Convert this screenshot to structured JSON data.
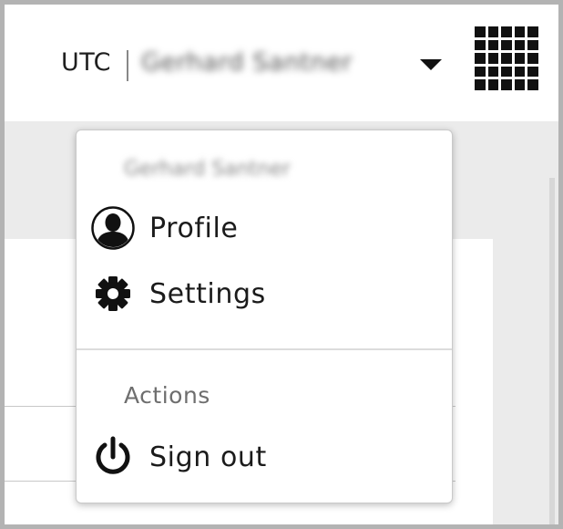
{
  "header": {
    "timezone": "UTC",
    "username": "Gerhard Santner",
    "dropdown_icon": "chevron-down-icon",
    "apps_icon": "app-grid-icon"
  },
  "menu": {
    "username": "Gerhard Santner",
    "items": [
      {
        "label": "Profile",
        "icon": "profile-icon"
      },
      {
        "label": "Settings",
        "icon": "gear-icon"
      }
    ],
    "actions_heading": "Actions",
    "actions": [
      {
        "label": "Sign out",
        "icon": "power-icon"
      }
    ]
  }
}
